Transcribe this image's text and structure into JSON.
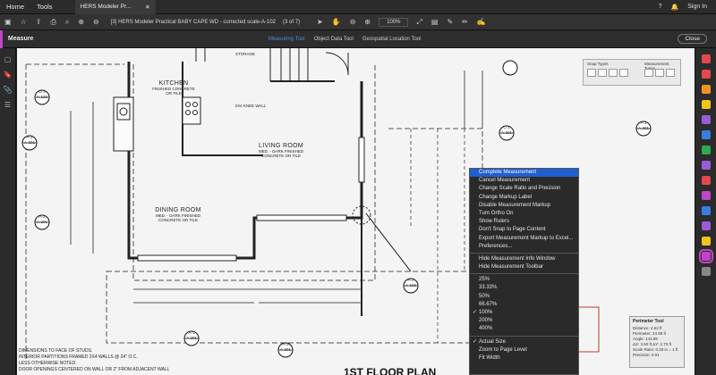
{
  "menubar": {
    "home": "Home",
    "tools": "Tools",
    "tab_label": "HERS Modeler Pr...",
    "signin": "Sign In"
  },
  "toolbar": {
    "doc_title": "[3] HERS Modeler Practical BABY CAPE WD - corrected scale-A-102",
    "page_info": "(3 of 7)",
    "zoom": "100%"
  },
  "measurebar": {
    "title": "Measure",
    "measuring_tool": "Measuring Tool",
    "object_data_tool": "Object Data Tool",
    "geospatial_tool": "Geospatial Location Tool",
    "close": "Close"
  },
  "snap_panel": {
    "snap_types": "Snap Types",
    "measurement_types": "Measurement Types"
  },
  "plan": {
    "kitchen": "KITCHEN",
    "kitchen_sub1": "FINISHED CONCRETE",
    "kitchen_sub2": "OR TILE",
    "living": "LIVING ROOM",
    "living_sub1": "MED. - DARK FINISHED",
    "living_sub2": "CONCRETE OR TILE",
    "dining": "DINING ROOM",
    "dining_sub1": "MED. - DARK FINISHED",
    "dining_sub2": "CONCRETE OR TILE",
    "wall_note": "2X4 KNEE WALL",
    "storage": "STORAGE",
    "notes": [
      "DIMENSIONS TO FACE OF STUDS.",
      "INTERIOR PARTITIONS FRAMED 2X4 WALLS @ 24\" O.C.",
      "LESS OTHERWISE NOTED.",
      "DOOR OPENINGS CENTERED ON WALL OR 2\" FROM ADJACENT WALL"
    ],
    "floor_title": "1ST FLOOR PLAN",
    "markers": [
      {
        "top": "D-3",
        "bottom": "A-102"
      },
      {
        "top": "A-1",
        "bottom": "A-201"
      },
      {
        "top": "A-2",
        "bottom": "A-201"
      },
      {
        "top": "A-1",
        "bottom": "A-201"
      },
      {
        "top": "A-3",
        "bottom": "A-201"
      },
      {
        "top": "C-1",
        "bottom": "A-201"
      },
      {
        "top": "A-1",
        "bottom": "A-201"
      },
      {
        "top": "A-2",
        "bottom": "A-102"
      }
    ]
  },
  "context_menu": {
    "items": [
      "Complete Measurement",
      "Cancel Measurement",
      "Change Scale Ratio and Precision",
      "Change Markup Label",
      "Disable Measurement Markup",
      "Turn Ortho On",
      "Show Rulers",
      "Don't Snap to Page Content",
      "Export Measurement Markup to Excel...",
      "Preferences..."
    ],
    "items2": [
      "Hide Measurement Info Window",
      "Hide Measurement Toolbar"
    ],
    "zoom_items": [
      "25%",
      "33.33%",
      "50%",
      "66.67%",
      "100%",
      "200%",
      "400%"
    ],
    "checked_zoom": "✓",
    "view_items": [
      "Actual Size",
      "Zoom to Page Level",
      "Fit Width"
    ]
  },
  "perimeter": {
    "title": "Perimeter Tool",
    "rows": [
      "Distance: 4.52 ft",
      "Perimeter: 24.99 ft",
      "Angle: 143.89",
      "ΔX: 3.60 ft   ΔY: 2.73 ft",
      "Scale Ratio: 0.25 in = 1 ft",
      "Precision: 0.01"
    ]
  }
}
